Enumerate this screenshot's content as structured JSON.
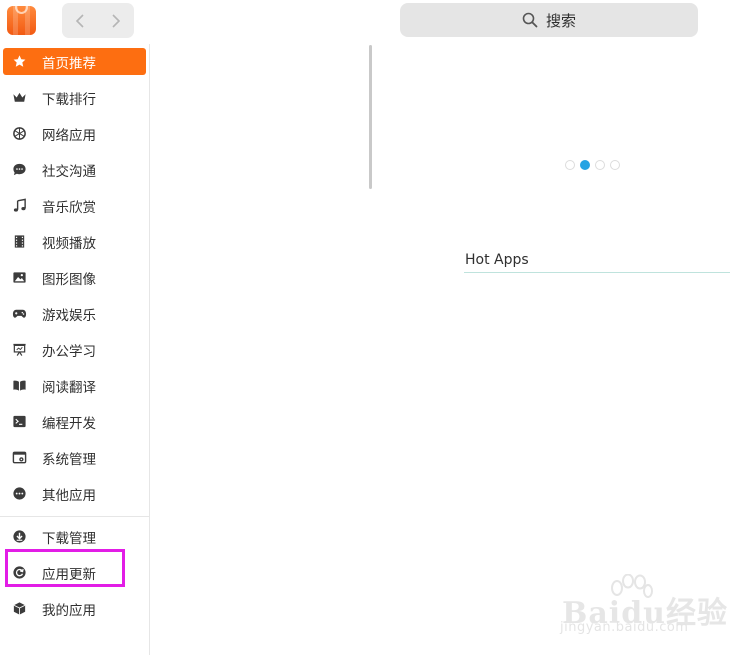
{
  "header": {
    "search_label": "搜索"
  },
  "sidebar": {
    "items": [
      {
        "label": "首页推荐",
        "icon": "star-icon",
        "active": true
      },
      {
        "label": "下载排行",
        "icon": "crown-icon"
      },
      {
        "label": "网络应用",
        "icon": "globe-icon"
      },
      {
        "label": "社交沟通",
        "icon": "chat-icon"
      },
      {
        "label": "音乐欣赏",
        "icon": "music-note-icon"
      },
      {
        "label": "视频播放",
        "icon": "film-icon"
      },
      {
        "label": "图形图像",
        "icon": "image-icon"
      },
      {
        "label": "游戏娱乐",
        "icon": "gamepad-icon"
      },
      {
        "label": "办公学习",
        "icon": "presentation-icon"
      },
      {
        "label": "阅读翻译",
        "icon": "book-icon"
      },
      {
        "label": "编程开发",
        "icon": "terminal-icon"
      },
      {
        "label": "系统管理",
        "icon": "system-settings-icon"
      },
      {
        "label": "其他应用",
        "icon": "more-icon"
      }
    ],
    "bottom_items": [
      {
        "label": "下载管理",
        "icon": "download-icon"
      },
      {
        "label": "应用更新",
        "icon": "refresh-icon"
      },
      {
        "label": "我的应用",
        "icon": "box-icon"
      }
    ]
  },
  "main": {
    "carousel": {
      "count": 4,
      "active_index": 1
    },
    "section_title": "Hot Apps"
  },
  "watermark": {
    "text": "Baidu经验",
    "subtext": "jingyan.baidu.com"
  },
  "colors": {
    "accent": "#fd6e11",
    "highlight": "#e21de6",
    "carousel_active": "#25a3e3"
  }
}
